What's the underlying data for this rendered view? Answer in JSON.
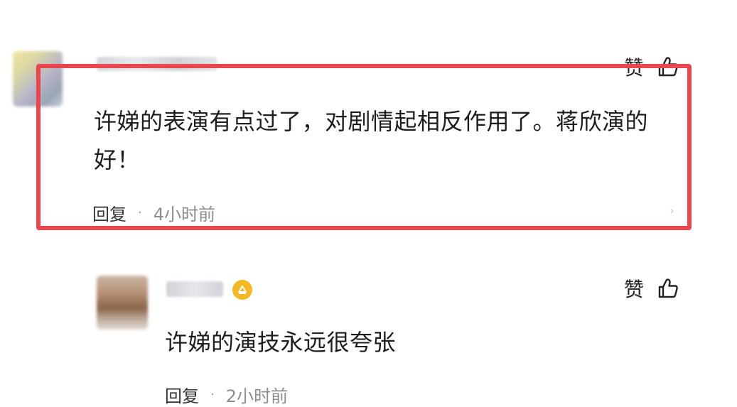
{
  "comments": [
    {
      "like_label": "赞",
      "text": "许娣的表演有点过了，对剧情起相反作用了。蒋欣演的好！",
      "reply_label": "回复",
      "separator": "·",
      "time": "4小时前",
      "chevron": "›"
    },
    {
      "like_label": "赞",
      "text": "许娣的演技永远很夸张",
      "reply_label": "回复",
      "separator": "·",
      "time": "2小时前"
    }
  ],
  "icons": {
    "like": "thumbs-up-icon",
    "verified": "verified-badge-icon",
    "chevron": "chevron-right-icon"
  },
  "colors": {
    "highlight_border": "#e8484d",
    "verified_badge": "#f3b825",
    "time_text": "#8c8c8c"
  }
}
